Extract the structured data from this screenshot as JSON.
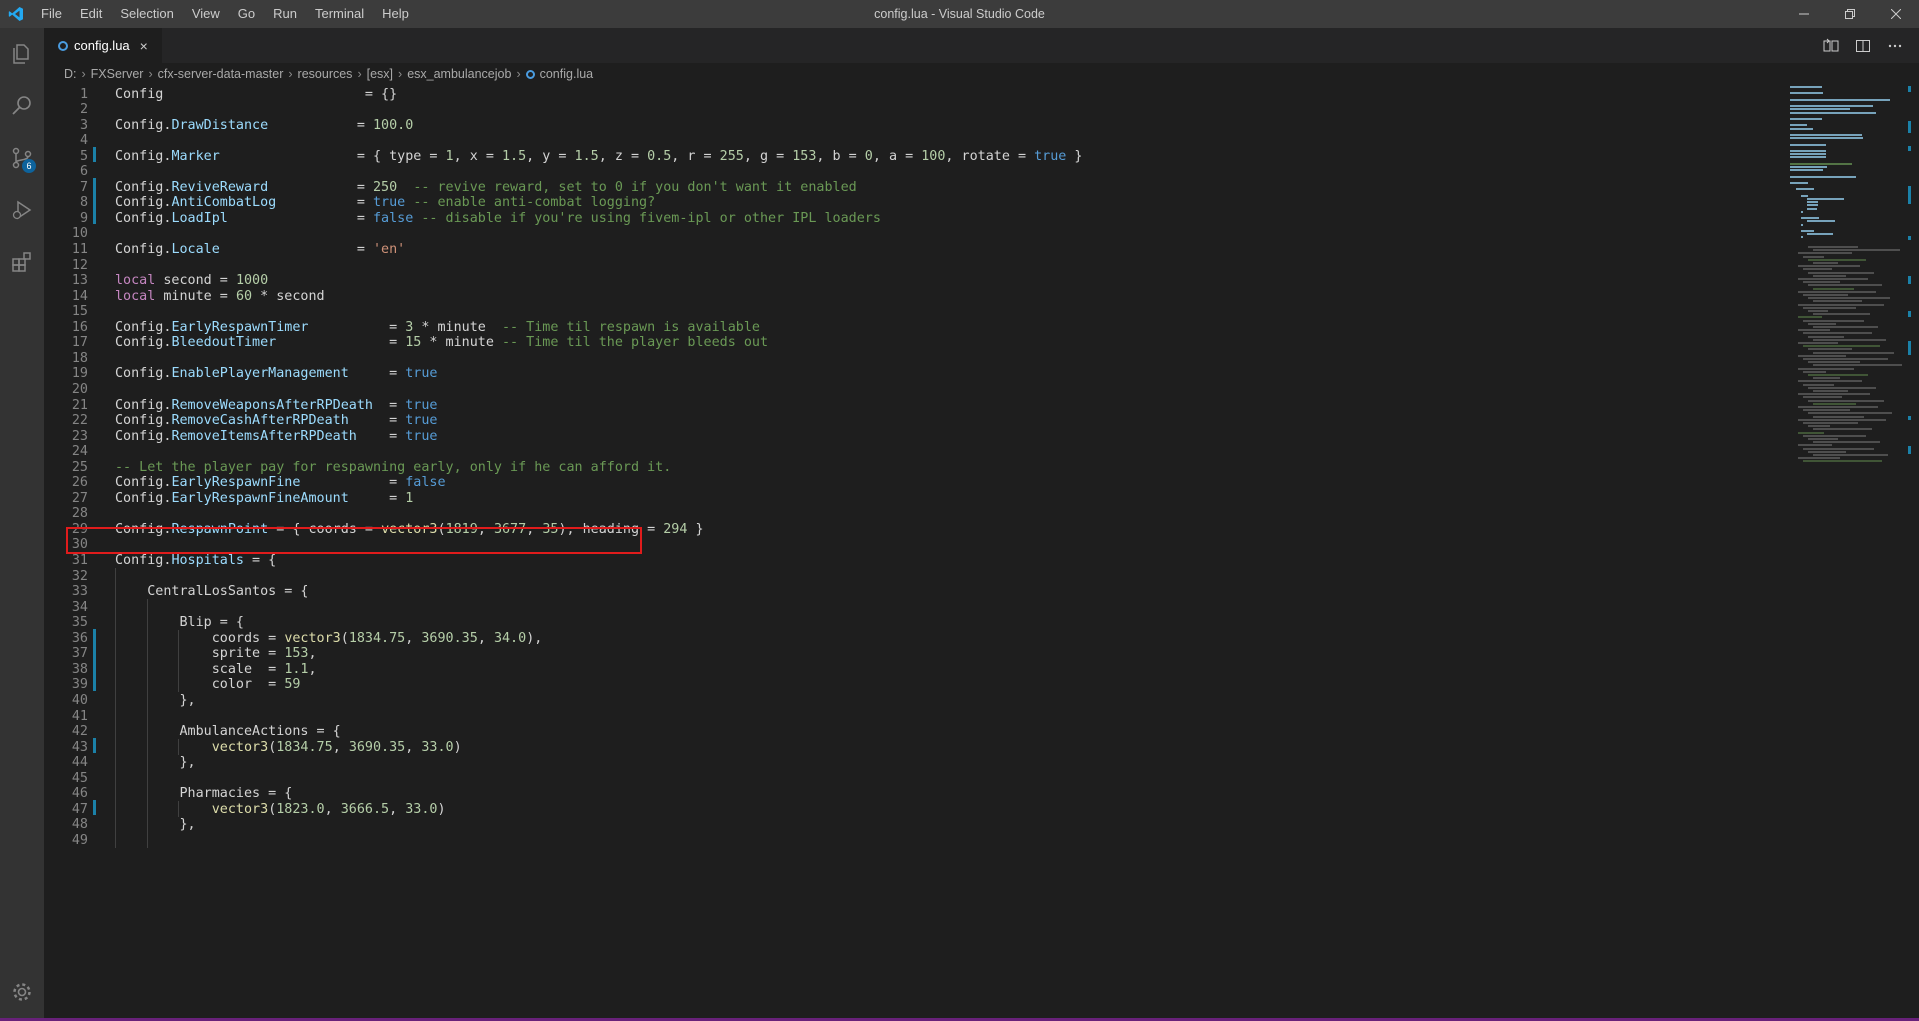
{
  "titlebar": {
    "menu": [
      "File",
      "Edit",
      "Selection",
      "View",
      "Go",
      "Run",
      "Terminal",
      "Help"
    ],
    "title": "config.lua - Visual Studio Code"
  },
  "activitybar": {
    "scm_badge": "6"
  },
  "tab": {
    "label": "config.lua",
    "close": "×"
  },
  "breadcrumb": [
    "D:",
    "FXServer",
    "cfx-server-data-master",
    "resources",
    "[esx]",
    "esx_ambulancejob",
    "config.lua"
  ],
  "editor": {
    "language": "lua",
    "lines": [
      "Config                         = {}",
      "",
      "Config.DrawDistance           = 100.0",
      "",
      "Config.Marker                 = { type = 1, x = 1.5, y = 1.5, z = 0.5, r = 255, g = 153, b = 0, a = 100, rotate = true }",
      "",
      "Config.ReviveReward           = 250  -- revive reward, set to 0 if you don't want it enabled",
      "Config.AntiCombatLog          = true -- enable anti-combat logging?",
      "Config.LoadIpl                = false -- disable if you're using fivem-ipl or other IPL loaders",
      "",
      "Config.Locale                 = 'en'",
      "",
      "local second = 1000",
      "local minute = 60 * second",
      "",
      "Config.EarlyRespawnTimer          = 3 * minute  -- Time til respawn is available",
      "Config.BleedoutTimer              = 15 * minute -- Time til the player bleeds out",
      "",
      "Config.EnablePlayerManagement     = true",
      "",
      "Config.RemoveWeaponsAfterRPDeath  = true",
      "Config.RemoveCashAfterRPDeath     = true",
      "Config.RemoveItemsAfterRPDeath    = true",
      "",
      "-- Let the player pay for respawning early, only if he can afford it.",
      "Config.EarlyRespawnFine           = false",
      "Config.EarlyRespawnFineAmount     = 1",
      "",
      "Config.RespawnPoint = { coords = vector3(1819, 3677, 35), heading = 294 }",
      "",
      "Config.Hospitals = {",
      "",
      "    CentralLosSantos = {",
      "",
      "        Blip = {",
      "            coords = vector3(1834.75, 3690.35, 34.0),",
      "            sprite = 153,",
      "            scale  = 1.1,",
      "            color  = 59",
      "        },",
      "",
      "        AmbulanceActions = {",
      "            vector3(1834.75, 3690.35, 33.0)",
      "        },",
      "",
      "        Pharmacies = {",
      "            vector3(1823.0, 3666.5, 33.0)",
      "        },",
      ""
    ],
    "modified_lines": [
      5,
      7,
      8,
      9,
      36,
      37,
      38,
      39,
      43,
      47
    ],
    "highlighted_line": 29,
    "colors": {
      "keyword": "#569cd6",
      "local": "#c586c0",
      "property": "#9cdcfe",
      "number": "#b5cea8",
      "string": "#ce9178",
      "comment": "#6a9955",
      "function": "#dcdcaa",
      "highlight_box": "#e01c1c",
      "gutter_modified": "#1b81a8"
    }
  }
}
